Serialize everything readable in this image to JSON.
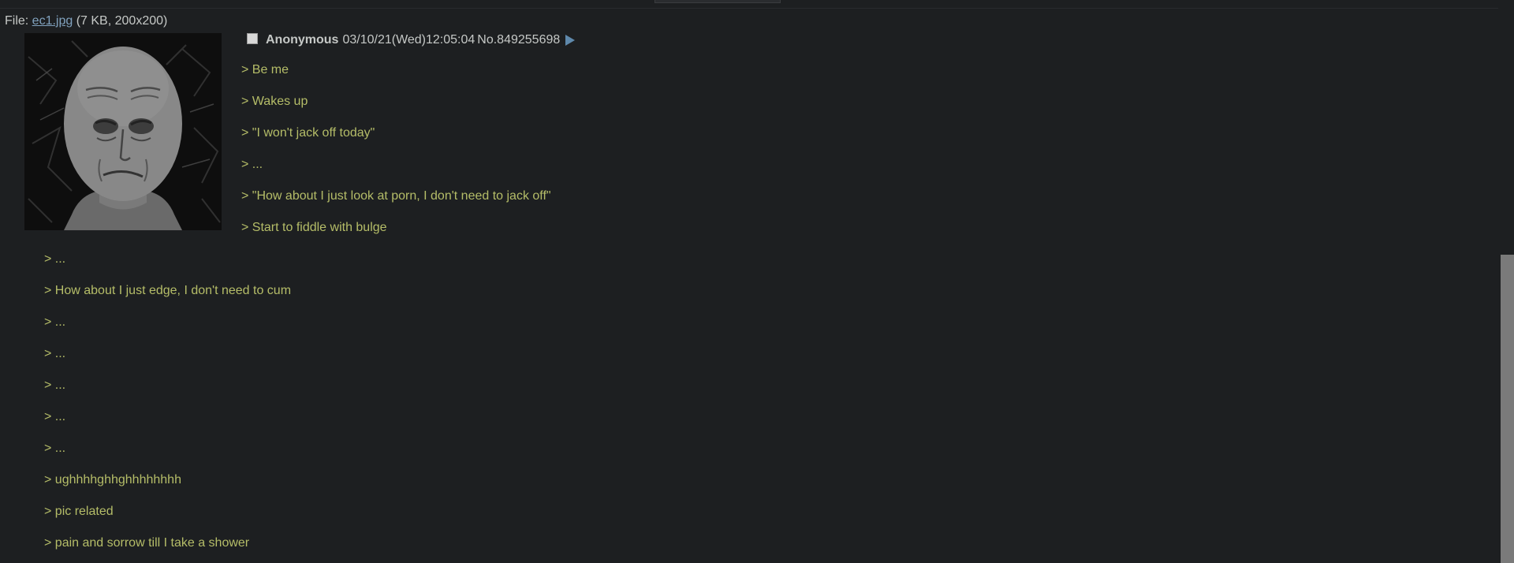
{
  "file_info": {
    "prefix": "File: ",
    "filename": "ec1.jpg",
    "meta": " (7 KB, 200x200)"
  },
  "post": {
    "name": "Anonymous",
    "date": "03/10/21(Wed)12:05:04",
    "number": "No.849255698"
  },
  "body_lines": [
    "> Be me",
    "> Wakes up",
    "> \"I won't jack off today\"",
    "> ...",
    "> \"How about I just look at porn, I don't need to jack off\"",
    "> Start to fiddle with bulge",
    "> ...",
    "> How about I just edge, I don't need to cum",
    "> ...",
    "> ...",
    "> ...",
    "> ...",
    "> ...",
    "> ughhhhghhghhhhhhhh",
    "> pic related",
    "> pain and sorrow till I take a shower"
  ],
  "colors": {
    "background": "#1d1f21",
    "text": "#c5c8c6",
    "greentext": "#b5bd68",
    "link": "#81a2be",
    "scrollbar_thumb": "#7a7a7a"
  },
  "icons": {
    "thumbnail": "wojak-sad-face-image",
    "post_menu": "triangle-right-icon"
  }
}
